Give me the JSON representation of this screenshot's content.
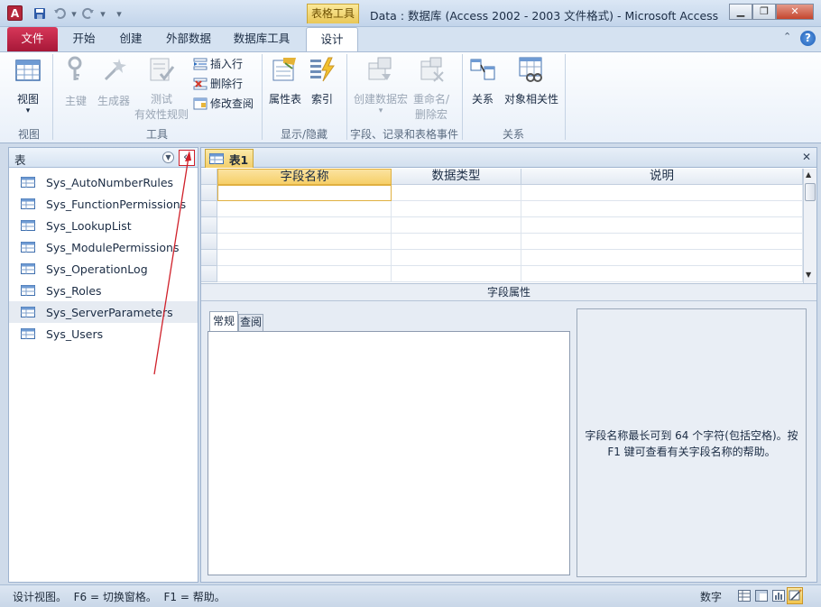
{
  "window": {
    "app_logo": "A",
    "title": "Data : 数据库 (Access 2002 - 2003 文件格式)  -  Microsoft Access",
    "context_tab": "表格工具",
    "minimize": "▁",
    "restore": "❐",
    "close": "✕"
  },
  "quick_access": {
    "save": "save-icon",
    "undo": "undo-icon",
    "redo": "redo-icon",
    "customize": "▾"
  },
  "tabs": [
    {
      "label": "文件"
    },
    {
      "label": "开始"
    },
    {
      "label": "创建"
    },
    {
      "label": "外部数据"
    },
    {
      "label": "数据库工具"
    },
    {
      "label": "设计"
    }
  ],
  "ribbon": {
    "view_group": {
      "view": "视图",
      "label": "视图"
    },
    "tools_group": {
      "primary_key": "主键",
      "builder": "生成器",
      "test_line1": "测试",
      "test_line2": "有效性规则",
      "insert_row": "插入行",
      "delete_row": "删除行",
      "modify_lookup": "修改查阅",
      "label": "工具"
    },
    "showhide_group": {
      "property_sheet": "属性表",
      "indexes": "索引",
      "label": "显示/隐藏"
    },
    "events_group": {
      "create_macro": "创建数据宏",
      "rename_line1": "重命名/",
      "rename_line2": "删除宏",
      "label": "字段、记录和表格事件"
    },
    "relations_group": {
      "relationships": "关系",
      "dependencies": "对象相关性",
      "label": "关系"
    }
  },
  "nav_pane": {
    "title": "表",
    "collapse": "«",
    "items": [
      {
        "label": "Sys_AutoNumberRules"
      },
      {
        "label": "Sys_FunctionPermissions"
      },
      {
        "label": "Sys_LookupList"
      },
      {
        "label": "Sys_ModulePermissions"
      },
      {
        "label": "Sys_OperationLog"
      },
      {
        "label": "Sys_Roles"
      },
      {
        "label": "Sys_ServerParameters"
      },
      {
        "label": "Sys_Users"
      }
    ],
    "selected_index": 6
  },
  "document": {
    "tab_label": "表1",
    "close": "✕",
    "columns": [
      "字段名称",
      "数据类型",
      "说明"
    ],
    "field_properties_title": "字段属性",
    "property_tabs": [
      "常规",
      "查阅"
    ],
    "help_text": "字段名称最长可到 64 个字符(包括空格)。按 F1 键可查看有关字段名称的帮助。"
  },
  "status_bar": {
    "text": "设计视图。  F6 = 切换窗格。  F1 = 帮助。",
    "numlock": "数字"
  },
  "colors": {
    "file_tab": "#c3244a",
    "context_tab": "#f0cf60",
    "ribbon_bg": "#e9f0f9",
    "annotation_arrow": "#d0202a"
  }
}
